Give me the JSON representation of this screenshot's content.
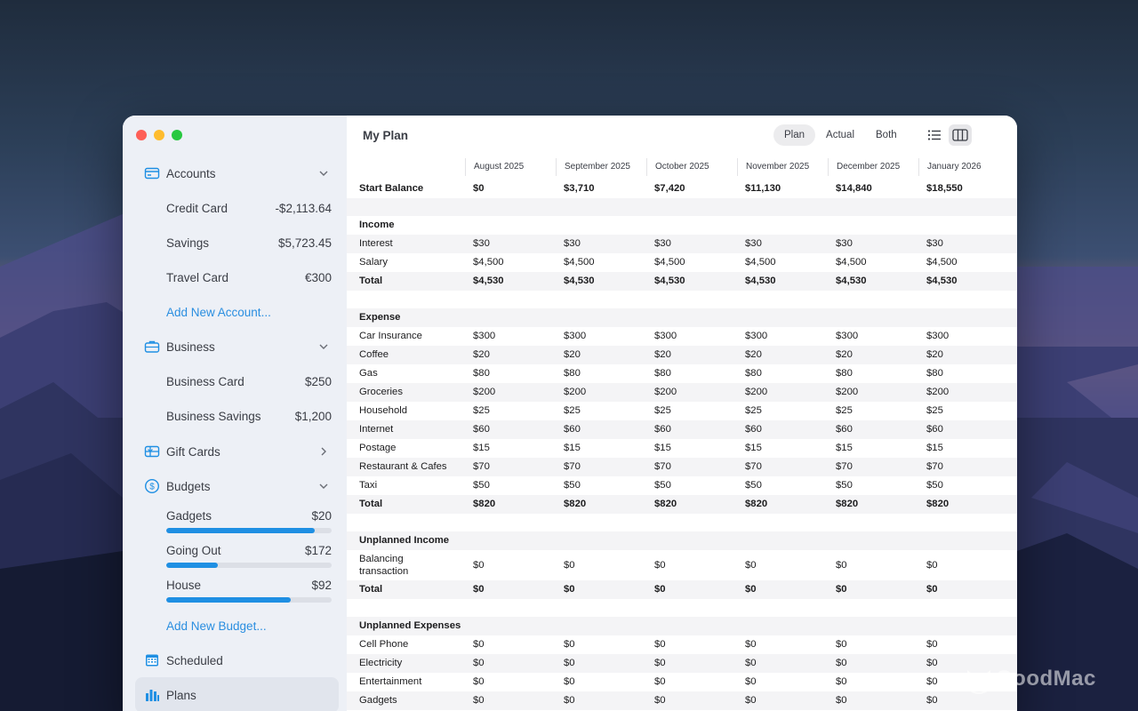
{
  "watermark": "GoodMac",
  "sidebar": {
    "accounts": {
      "label": "Accounts",
      "items": [
        {
          "label": "Credit Card",
          "amount": "-$2,113.64"
        },
        {
          "label": "Savings",
          "amount": "$5,723.45"
        },
        {
          "label": "Travel Card",
          "amount": "€300"
        }
      ],
      "add_label": "Add New Account..."
    },
    "business": {
      "label": "Business",
      "items": [
        {
          "label": "Business Card",
          "amount": "$250"
        },
        {
          "label": "Business Savings",
          "amount": "$1,200"
        }
      ]
    },
    "gift_cards": {
      "label": "Gift Cards"
    },
    "budgets": {
      "label": "Budgets",
      "items": [
        {
          "label": "Gadgets",
          "amount": "$20",
          "progress": 0.9
        },
        {
          "label": "Going Out",
          "amount": "$172",
          "progress": 0.31
        },
        {
          "label": "House",
          "amount": "$92",
          "progress": 0.75
        }
      ],
      "add_label": "Add New Budget..."
    },
    "scheduled": {
      "label": "Scheduled"
    },
    "plans": {
      "label": "Plans"
    }
  },
  "main": {
    "title": "My Plan",
    "segments": [
      "Plan",
      "Actual",
      "Both"
    ],
    "active_segment": "Plan",
    "columns": [
      "August 2025",
      "September 2025",
      "October 2025",
      "November 2025",
      "December 2025",
      "January 2026"
    ],
    "rows": [
      {
        "type": "bold",
        "label": "Start Balance",
        "values": [
          "$0",
          "$3,710",
          "$7,420",
          "$11,130",
          "$14,840",
          "$18,550"
        ]
      },
      {
        "type": "spacer"
      },
      {
        "type": "section",
        "label": "Income"
      },
      {
        "type": "row",
        "label": "Interest",
        "values": [
          "$30",
          "$30",
          "$30",
          "$30",
          "$30",
          "$30"
        ]
      },
      {
        "type": "row",
        "label": "Salary",
        "values": [
          "$4,500",
          "$4,500",
          "$4,500",
          "$4,500",
          "$4,500",
          "$4,500"
        ]
      },
      {
        "type": "bold",
        "label": "Total",
        "values": [
          "$4,530",
          "$4,530",
          "$4,530",
          "$4,530",
          "$4,530",
          "$4,530"
        ]
      },
      {
        "type": "spacer"
      },
      {
        "type": "section",
        "label": "Expense"
      },
      {
        "type": "row",
        "label": "Car Insurance",
        "values": [
          "$300",
          "$300",
          "$300",
          "$300",
          "$300",
          "$300"
        ]
      },
      {
        "type": "row",
        "label": "Coffee",
        "values": [
          "$20",
          "$20",
          "$20",
          "$20",
          "$20",
          "$20"
        ]
      },
      {
        "type": "row",
        "label": "Gas",
        "values": [
          "$80",
          "$80",
          "$80",
          "$80",
          "$80",
          "$80"
        ]
      },
      {
        "type": "row",
        "label": "Groceries",
        "values": [
          "$200",
          "$200",
          "$200",
          "$200",
          "$200",
          "$200"
        ]
      },
      {
        "type": "row",
        "label": "Household",
        "values": [
          "$25",
          "$25",
          "$25",
          "$25",
          "$25",
          "$25"
        ]
      },
      {
        "type": "row",
        "label": "Internet",
        "values": [
          "$60",
          "$60",
          "$60",
          "$60",
          "$60",
          "$60"
        ]
      },
      {
        "type": "row",
        "label": "Postage",
        "values": [
          "$15",
          "$15",
          "$15",
          "$15",
          "$15",
          "$15"
        ]
      },
      {
        "type": "row",
        "label": "Restaurant & Cafes",
        "values": [
          "$70",
          "$70",
          "$70",
          "$70",
          "$70",
          "$70"
        ]
      },
      {
        "type": "row",
        "label": "Taxi",
        "values": [
          "$50",
          "$50",
          "$50",
          "$50",
          "$50",
          "$50"
        ]
      },
      {
        "type": "bold",
        "label": "Total",
        "values": [
          "$820",
          "$820",
          "$820",
          "$820",
          "$820",
          "$820"
        ]
      },
      {
        "type": "spacer"
      },
      {
        "type": "section",
        "label": "Unplanned Income"
      },
      {
        "type": "tall",
        "label": "Balancing transaction",
        "values": [
          "$0",
          "$0",
          "$0",
          "$0",
          "$0",
          "$0"
        ]
      },
      {
        "type": "bold",
        "label": "Total",
        "values": [
          "$0",
          "$0",
          "$0",
          "$0",
          "$0",
          "$0"
        ]
      },
      {
        "type": "spacer"
      },
      {
        "type": "section",
        "label": "Unplanned Expenses"
      },
      {
        "type": "row",
        "label": "Cell Phone",
        "values": [
          "$0",
          "$0",
          "$0",
          "$0",
          "$0",
          "$0"
        ]
      },
      {
        "type": "row",
        "label": "Electricity",
        "values": [
          "$0",
          "$0",
          "$0",
          "$0",
          "$0",
          "$0"
        ]
      },
      {
        "type": "row",
        "label": "Entertainment",
        "values": [
          "$0",
          "$0",
          "$0",
          "$0",
          "$0",
          "$0"
        ]
      },
      {
        "type": "row",
        "label": "Gadgets",
        "values": [
          "$0",
          "$0",
          "$0",
          "$0",
          "$0",
          "$0"
        ]
      }
    ]
  }
}
